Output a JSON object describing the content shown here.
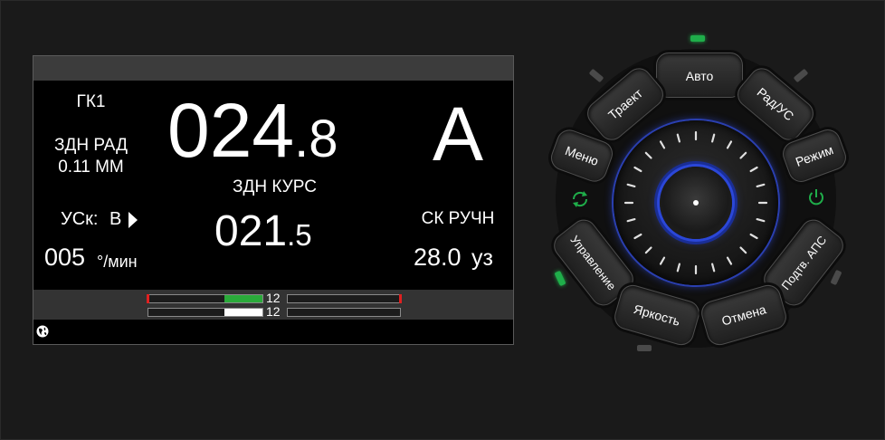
{
  "screen": {
    "top_left": {
      "label": "ГК1",
      "line2": "ЗДН РАД",
      "line3": "0.11 ММ"
    },
    "main_heading": {
      "value_main": "024",
      "value_frac": ".8"
    },
    "heading_label": "ЗДН КУРС",
    "heading_set": {
      "value_main": "021",
      "value_frac": ".5"
    },
    "mode_letter": "А",
    "left_mid": {
      "label": "УСк:",
      "side": "В",
      "rate_value": "005",
      "rate_unit": "°/мин"
    },
    "right_mid": {
      "label": "СК РУЧН",
      "speed_value": "28.0",
      "speed_unit": "уз"
    },
    "bars": [
      {
        "value": "12",
        "color": "#2aaa3a",
        "fill_fraction": 0.5
      },
      {
        "value": "12",
        "color": "#ffffff",
        "fill_fraction": 0.5
      }
    ]
  },
  "controls": {
    "buttons": {
      "auto": "Авто",
      "track": "Траект",
      "rad_us": "Рад/УС",
      "menu": "Меню",
      "mode": "Режим",
      "steering": "Управление",
      "confirm": "Подтв. АПС",
      "brightness": "Яркость",
      "cancel": "Отмена"
    },
    "leds": {
      "auto": "on",
      "track": "off",
      "rad_us": "off",
      "steering": "on",
      "confirm": "off",
      "brightness": "off"
    },
    "colors": {
      "accent_green": "#1fae4a",
      "knob_blue": "#3a4fd0",
      "bar_green": "#2aaa3a",
      "marker_red": "#e02020"
    }
  }
}
